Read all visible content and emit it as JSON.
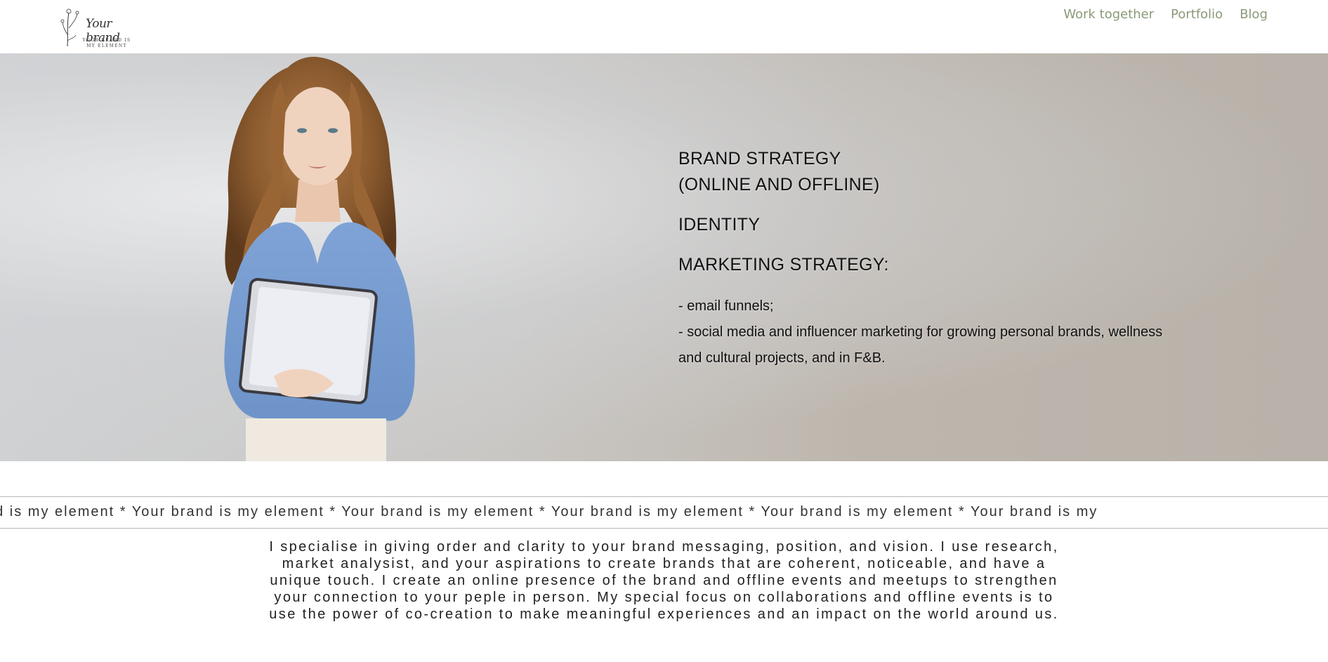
{
  "header": {
    "logo_script": "Your brand",
    "logo_tagline": "YOUR BRAND IS MY ELEMENT",
    "nav": [
      {
        "label": "Work together"
      },
      {
        "label": "Portfolio"
      },
      {
        "label": "Blog"
      }
    ]
  },
  "hero": {
    "heading_line1": "BRAND STRATEGY",
    "heading_line2": "(ONLINE AND OFFLINE)",
    "heading_identity": "IDENTITY",
    "heading_marketing": "MARKETING STRATEGY:",
    "bullet1": "- email funnels;",
    "bullet2_line1": "- social media and influencer marketing for growing personal brands, wellness",
    "bullet2_line2": "and cultural projects, and in F&B."
  },
  "marquee": {
    "text": "nd is my element * Your brand is my element * Your brand is my element * Your brand is my element * Your brand is my element * Your brand is my"
  },
  "about": {
    "text": "I specialise in giving order and clarity to your brand messaging, position, and vision. I use research, market analysist, and your aspirations to create brands that are coherent, noticeable, and have a unique touch. I create an online presence of the brand and offline events and meetups to strengthen your connection to your peple in person. My special focus on collaborations and offline events is to use the power of co-creation to make meaningful experiences and an impact on the world around us."
  },
  "colors": {
    "nav": "#8a9a78",
    "text": "#111111",
    "divider": "#b8b8b8"
  }
}
